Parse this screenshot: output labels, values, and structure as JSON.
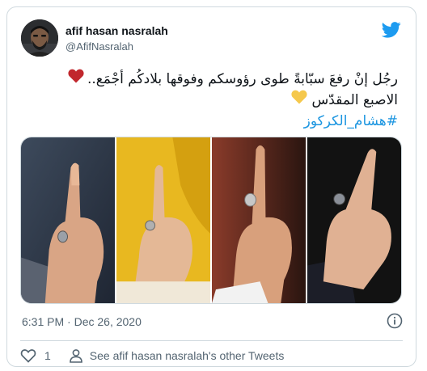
{
  "user": {
    "display_name": "afif hasan nasralah",
    "handle": "@AfifNasralah",
    "avatar_icon": "profile-photo"
  },
  "tweet": {
    "line1": "رجُل إنْ رفعَ سبّابةً طوى رؤوسكم وفوقها بلادكُم أجْمَع..",
    "line2": "الاصبع المقدّس",
    "hashtag": "#هشام_الكركوز"
  },
  "colors": {
    "brand_blue": "#1d9bf0",
    "hashtag_blue": "#1b95e0",
    "heart_red": "#c1272d",
    "heart_yellow": "#f5c84c"
  },
  "meta": {
    "timestamp": "6:31 PM · Dec 26, 2020"
  },
  "actions": {
    "like_count": "1",
    "other_tweets": "See afif hasan nasralah's other Tweets"
  }
}
